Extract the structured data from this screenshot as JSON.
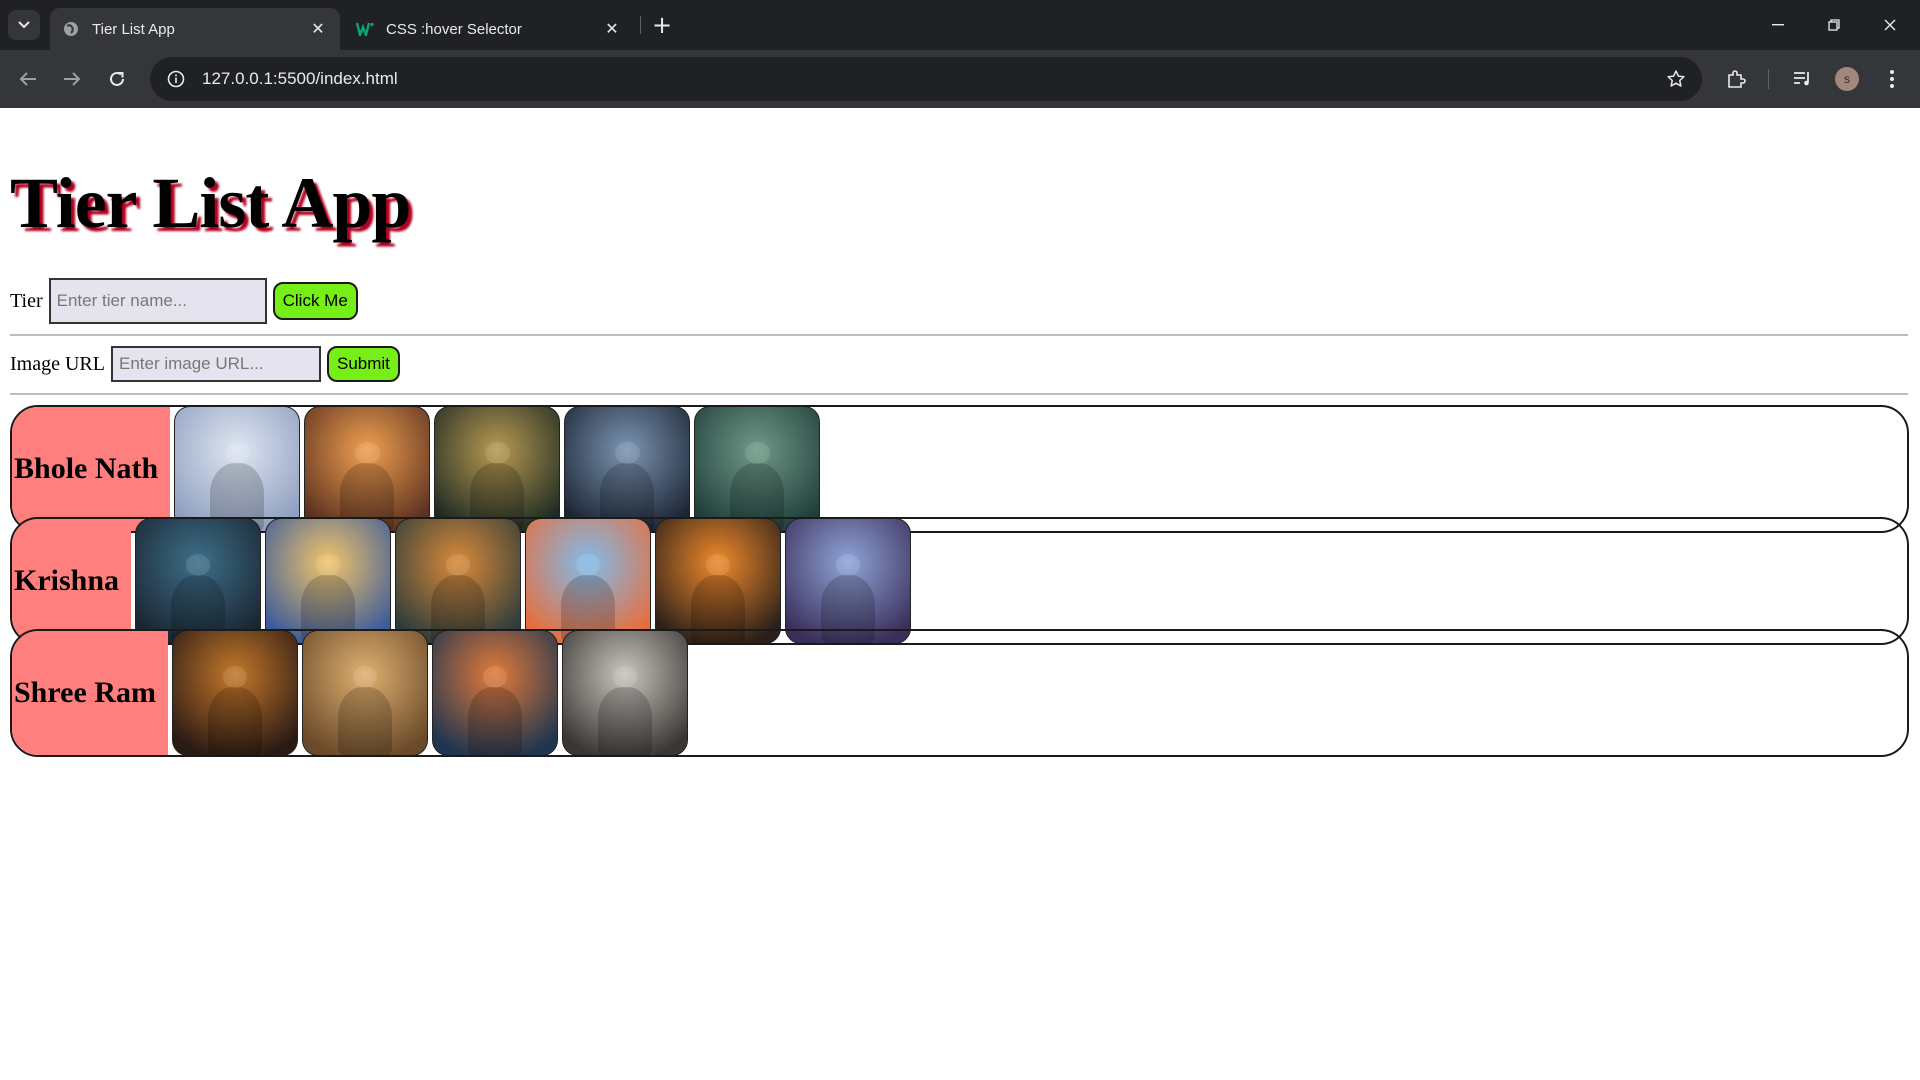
{
  "browser": {
    "tabs": [
      {
        "title": "Tier List App",
        "active": true
      },
      {
        "title": "CSS :hover Selector",
        "active": false
      }
    ],
    "url": "127.0.0.1:5500/index.html",
    "profile_initial": "s"
  },
  "page": {
    "title": "Tier List App",
    "tier_form": {
      "label": "Tier",
      "placeholder": "Enter tier name...",
      "button": "Click Me"
    },
    "image_form": {
      "label": "Image URL",
      "placeholder": "Enter image URL...",
      "button": "Submit"
    },
    "tiers": [
      {
        "name": "Bhole Nath",
        "images": [
          {
            "alt": "Shiva meditating in clouds",
            "colors": [
              "#dfe6f2",
              "#8f9fbf"
            ]
          },
          {
            "alt": "Shiva with fiery aura",
            "colors": [
              "#f0a050",
              "#5a3020"
            ]
          },
          {
            "alt": "Shiva seated golden temple",
            "colors": [
              "#b89a52",
              "#1d2a22"
            ]
          },
          {
            "alt": "Shiva with trident",
            "colors": [
              "#7c95b3",
              "#1b2433"
            ]
          },
          {
            "alt": "Deity in green mist",
            "colors": [
              "#6f9a88",
              "#1f3d3a"
            ]
          }
        ]
      },
      {
        "name": "Krishna",
        "images": [
          {
            "alt": "Krishna with flute dark",
            "colors": [
              "#3d6f8a",
              "#1a2530"
            ]
          },
          {
            "alt": "Krishna blue with flute",
            "colors": [
              "#f2c56a",
              "#3a5a9a"
            ]
          },
          {
            "alt": "Krishna seated with flowers",
            "colors": [
              "#d98a3a",
              "#2c3b3a"
            ]
          },
          {
            "alt": "Krishna in sky",
            "colors": [
              "#7fbcec",
              "#e86c3a"
            ]
          },
          {
            "alt": "Ram with glowing sun",
            "colors": [
              "#f08a2a",
              "#2a1f1a"
            ]
          },
          {
            "alt": "Shiva with cosmic lights",
            "colors": [
              "#8fa4d8",
              "#3b2f5a"
            ]
          }
        ]
      },
      {
        "name": "Shree Ram",
        "images": [
          {
            "alt": "Ram with crown",
            "colors": [
              "#c4782a",
              "#2a1a14"
            ]
          },
          {
            "alt": "Ram at temple",
            "colors": [
              "#e0b070",
              "#6a4a2a"
            ]
          },
          {
            "alt": "Ram with bow",
            "colors": [
              "#e27a3a",
              "#1f3550"
            ]
          },
          {
            "alt": "Sage under tree",
            "colors": [
              "#c9c5bf",
              "#3a3633"
            ]
          }
        ]
      }
    ]
  }
}
